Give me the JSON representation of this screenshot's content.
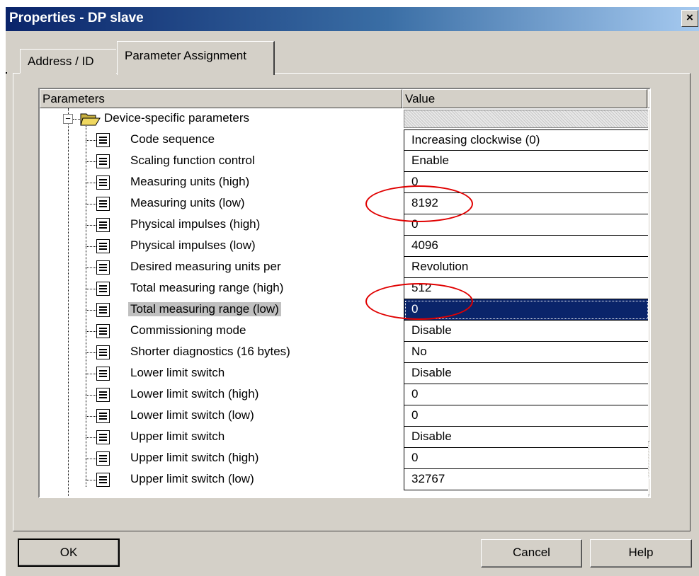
{
  "window": {
    "title": "Properties - DP slave",
    "close_glyph": "×"
  },
  "tabs": [
    {
      "label": "Address / ID",
      "active": false
    },
    {
      "label": "Parameter Assignment",
      "active": true
    }
  ],
  "grid": {
    "columns": {
      "parameters": "Parameters",
      "value": "Value"
    },
    "folder": {
      "label": "Device-specific parameters",
      "expander": "−",
      "icon": "open-folder-icon"
    },
    "rows": [
      {
        "label": "Code sequence",
        "value": "Increasing clockwise (0)"
      },
      {
        "label": "Scaling function control",
        "value": "Enable"
      },
      {
        "label": "Measuring units (high)",
        "value": "0"
      },
      {
        "label": "Measuring units (low)",
        "value": "8192"
      },
      {
        "label": "Physical impulses (high)",
        "value": "0"
      },
      {
        "label": "Physical impulses (low)",
        "value": "4096"
      },
      {
        "label": "Desired measuring units per",
        "value": "Revolution"
      },
      {
        "label": "Total measuring range (high)",
        "value": "512"
      },
      {
        "label": "Total measuring range (low)",
        "value": "0",
        "selected": true
      },
      {
        "label": "Commissioning mode",
        "value": "Disable"
      },
      {
        "label": "Shorter diagnostics (16 bytes)",
        "value": "No"
      },
      {
        "label": "Lower limit switch",
        "value": "Disable"
      },
      {
        "label": "Lower limit switch (high)",
        "value": "0"
      },
      {
        "label": "Lower limit switch (low)",
        "value": "0"
      },
      {
        "label": "Upper limit switch",
        "value": "Disable"
      },
      {
        "label": "Upper limit switch (high)",
        "value": "0"
      },
      {
        "label": "Upper limit switch (low)",
        "value": "32767"
      }
    ],
    "scroll": {
      "up_glyph": "▲",
      "down_glyph": "▼"
    }
  },
  "annotations": {
    "ellipse_color": "#e00000"
  },
  "buttons": {
    "ok": "OK",
    "cancel": "Cancel",
    "help": "Help"
  },
  "colors": {
    "title_bar": "#0a246a",
    "dialog_face": "#d4d0c8",
    "selection": "#0a246a"
  }
}
